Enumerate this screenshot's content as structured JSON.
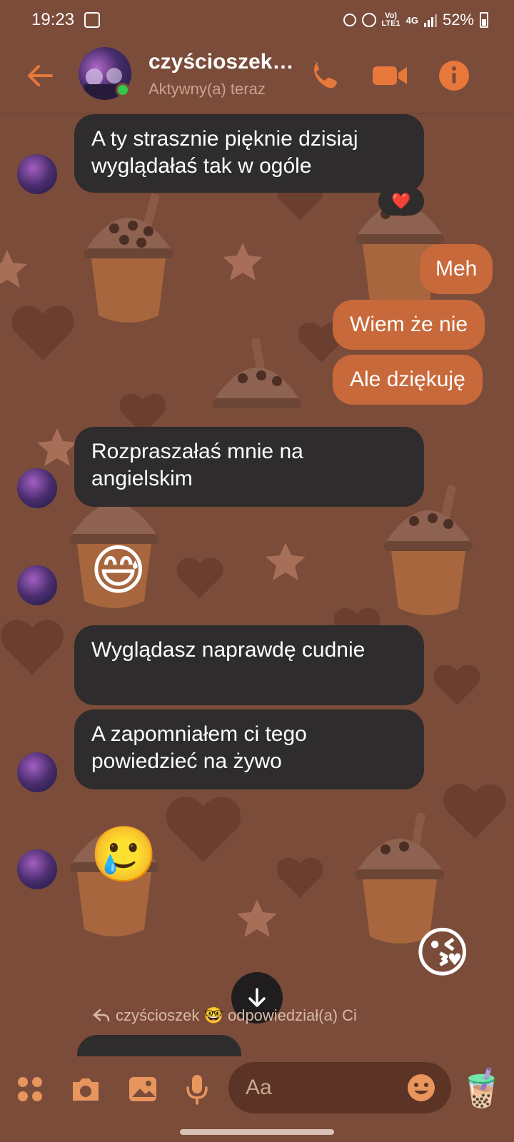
{
  "status_bar": {
    "time": "19:23",
    "network_top": "Vo)",
    "network_bottom": "LTE1",
    "network_type": "4G",
    "battery": "52%"
  },
  "header": {
    "contact_name": "czyścioszek…",
    "contact_status": "Aktywny(a) teraz",
    "back_icon": "arrow-left-icon",
    "call_icon": "phone-icon",
    "video_icon": "video-camera-icon",
    "info_icon": "info-icon"
  },
  "colors": {
    "accent": "#e8783a",
    "bubble_in": "#2e2c2c",
    "bubble_out": "#c8693b",
    "background": "#7b4c3a"
  },
  "messages": [
    {
      "from": "them",
      "text": "A ty strasznie pięknie dzisiaj wyglądałaś tak w ogóle",
      "reaction": "❤️"
    },
    {
      "from": "me",
      "text": "Meh"
    },
    {
      "from": "me",
      "text": "Wiem że nie"
    },
    {
      "from": "me",
      "text": "Ale dziękuję"
    },
    {
      "from": "them",
      "text": "Rozpraszałaś mnie na angielskim"
    },
    {
      "from": "them",
      "emoji": "😅"
    },
    {
      "from": "them",
      "text": "Wyglądasz naprawdę cudnie"
    },
    {
      "from": "them",
      "text": "A zapomniałem ci tego powiedzieć na żywo"
    },
    {
      "from": "them",
      "emoji": "🥲"
    },
    {
      "from": "me",
      "emoji": "😘"
    }
  ],
  "reply_preview": {
    "text": "czyścioszek 🤓 odpowiedział(a) Ci"
  },
  "composer": {
    "placeholder": "Aa",
    "menu_icon": "four-dots-menu-icon",
    "camera_icon": "camera-icon",
    "gallery_icon": "image-icon",
    "mic_icon": "microphone-icon",
    "emoji_icon": "smiley-icon",
    "quick_reaction": "🧋"
  }
}
